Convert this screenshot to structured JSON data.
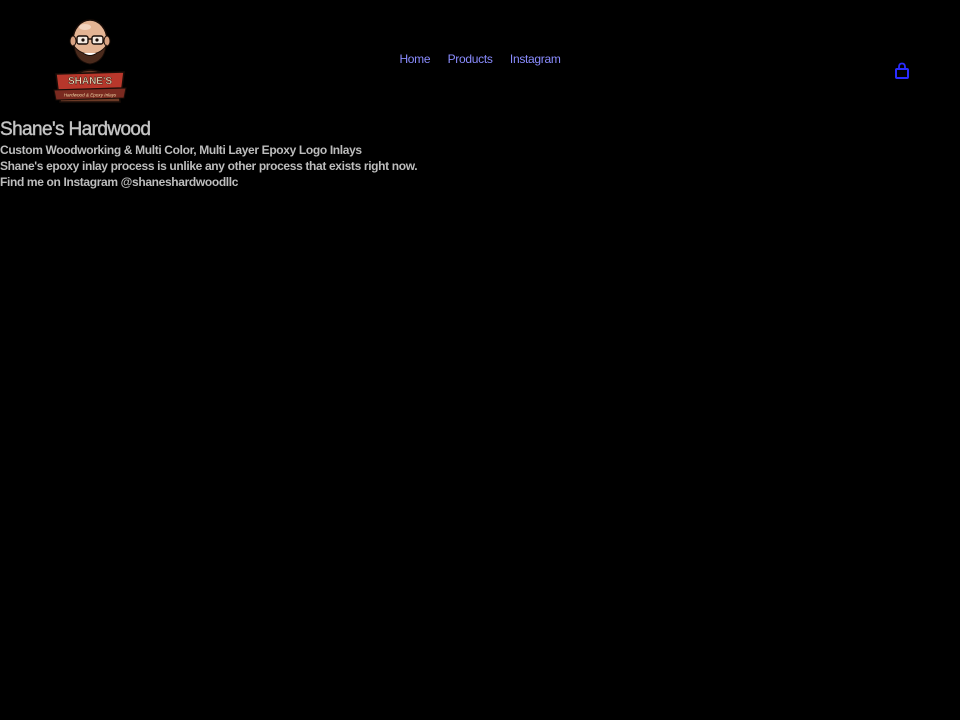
{
  "logo": {
    "name_text": "SHANE'S",
    "sub_text": "Hardwood & Epoxy Inlays"
  },
  "nav": {
    "items": [
      {
        "label": "Home"
      },
      {
        "label": "Products"
      },
      {
        "label": "Instagram"
      }
    ]
  },
  "cart": {
    "icon": "shopping-bag-icon"
  },
  "page": {
    "title": "Shane's Hardwood",
    "tagline": "Custom Woodworking & Multi Color, Multi Layer Epoxy Logo Inlays",
    "description": "Shane's epoxy inlay process is unlike any other process that exists right now.",
    "instagram_line": "Find me on Instagram @shaneshardwoodllc"
  },
  "colors": {
    "background": "#000000",
    "nav_link": "#8a8cff",
    "cart_icon": "#2a2cff",
    "body_text": "#bdbdbd"
  }
}
